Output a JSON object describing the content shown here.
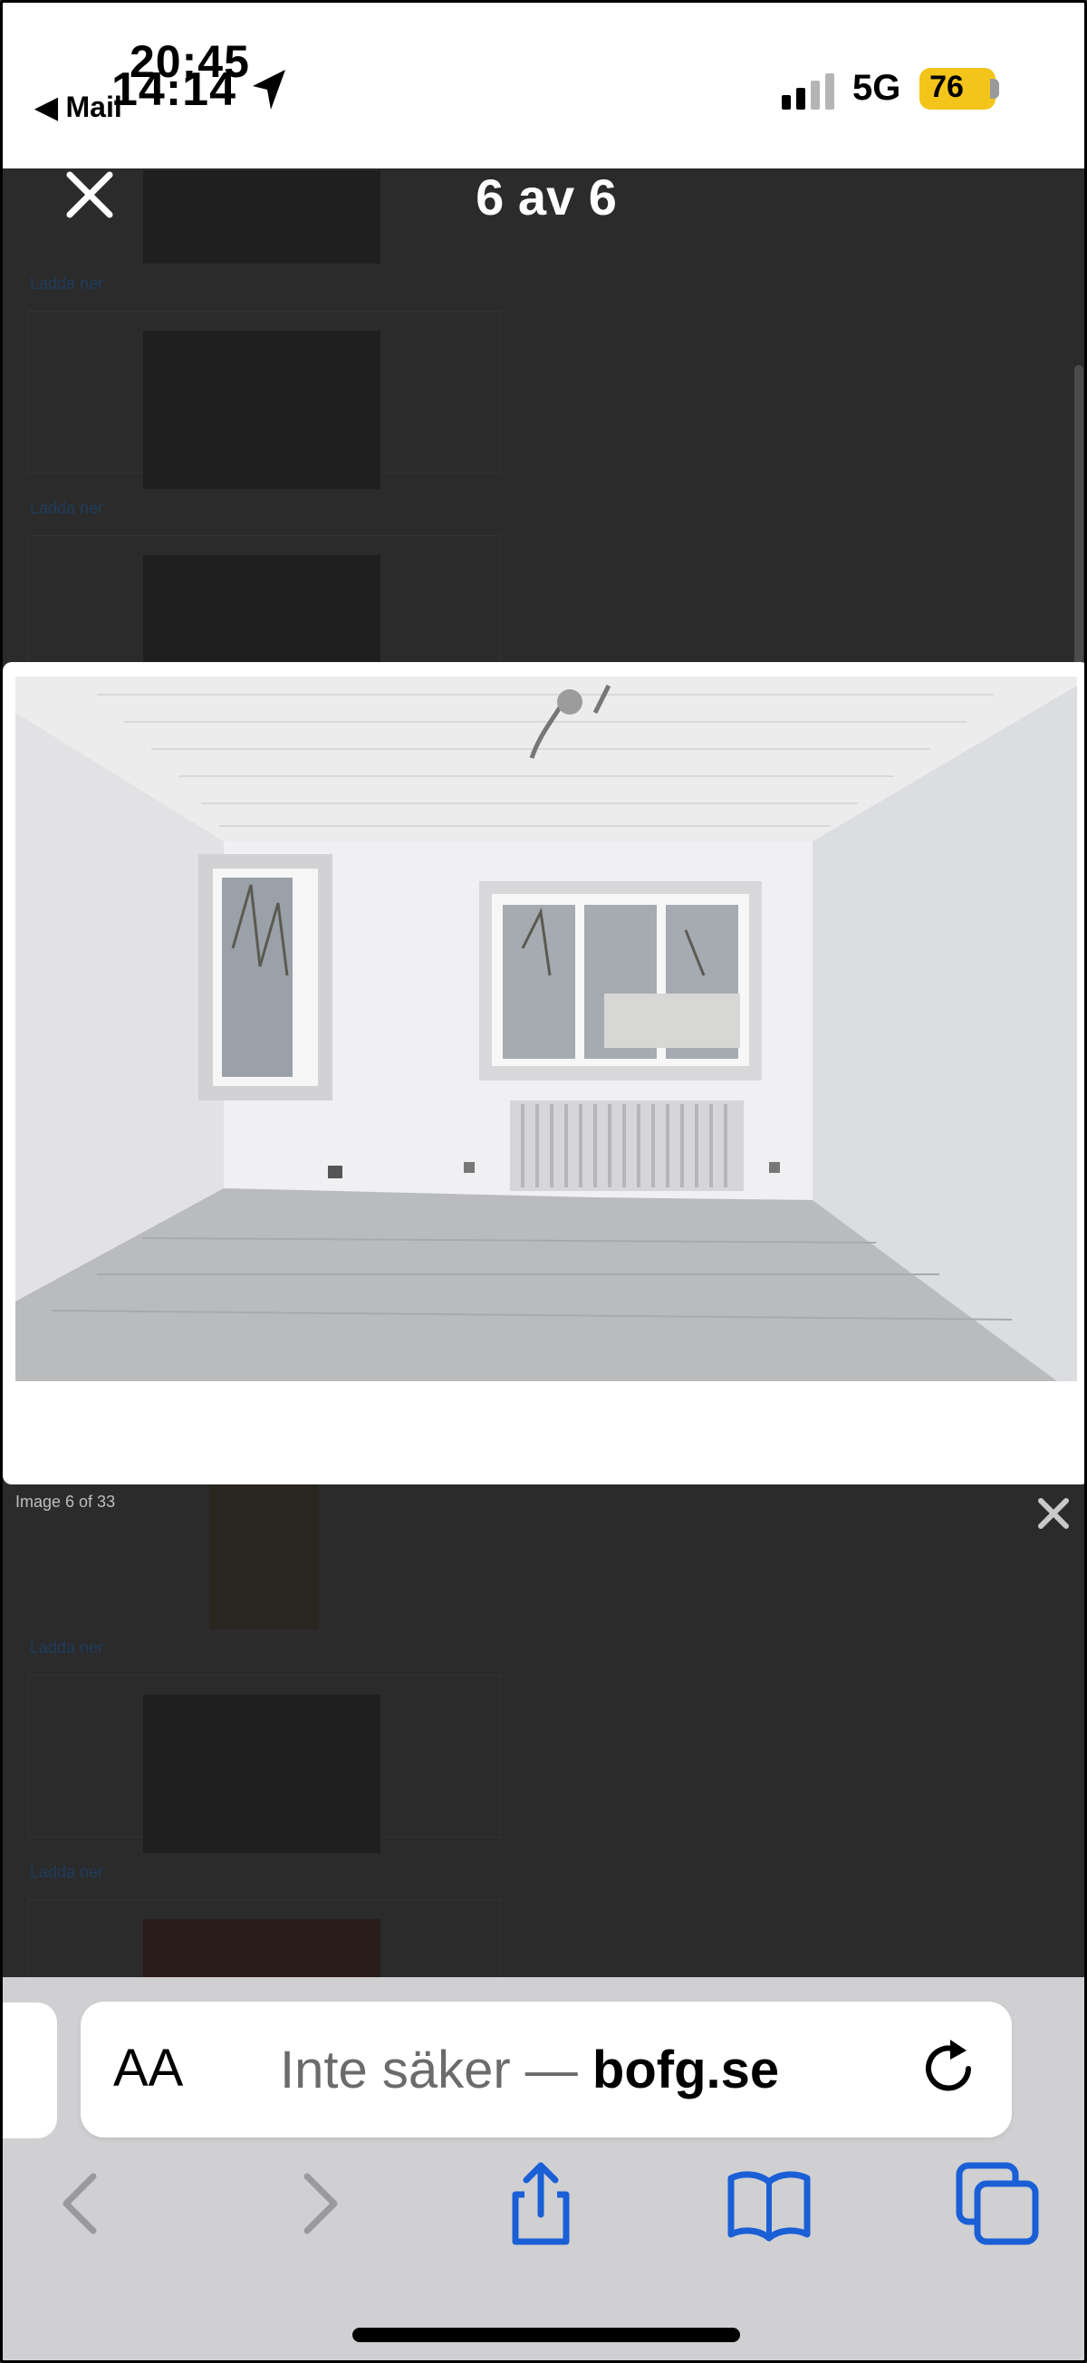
{
  "status_bar": {
    "time_top": "20:45",
    "time_under": "14:14",
    "back_app": "Mail",
    "network": "5G",
    "battery": "76"
  },
  "viewer": {
    "counter": "6 av 6"
  },
  "background_links": [
    "Ladda ner",
    "Ladda ner",
    "Ladda ner",
    "Ladda ner"
  ],
  "lightbox": {
    "caption": "Image 6 of 33"
  },
  "safari": {
    "text_size_label": "AA",
    "url_prefix": "Inte säker — ",
    "url_domain": "bofg.se"
  },
  "colors": {
    "accent": "#1a5fd6",
    "overlay": "#2b2b2c",
    "battery": "#f3c51b"
  }
}
